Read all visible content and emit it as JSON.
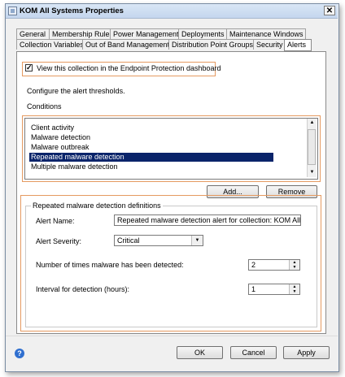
{
  "window": {
    "title": "KOM All Systems Properties",
    "close_label": "✕"
  },
  "tabs": {
    "row1": [
      "General",
      "Membership Rules",
      "Power Management",
      "Deployments",
      "Maintenance Windows"
    ],
    "row2": [
      "Collection Variables",
      "Out of Band Management",
      "Distribution Point Groups",
      "Security",
      "Alerts"
    ],
    "active": "Alerts"
  },
  "alerts": {
    "ep_checkbox_label": "View this collection in the Endpoint Protection dashboard",
    "ep_checked": true,
    "configure_text": "Configure the alert thresholds.",
    "conditions_label": "Conditions",
    "conditions": [
      "Client activity",
      "Malware detection",
      "Malware outbreak",
      "Repeated malware detection",
      "Multiple malware detection"
    ],
    "selected_condition": "Repeated malware detection",
    "add_button": "Add...",
    "remove_button": "Remove"
  },
  "definitions": {
    "group_title": "Repeated malware detection definitions",
    "alert_name_label": "Alert Name:",
    "alert_name_value": "Repeated malware detection alert for collection: KOM All Sys",
    "severity_label": "Alert Severity:",
    "severity_value": "Critical",
    "times_label": "Number of times malware has been detected:",
    "times_value": "2",
    "interval_label": "Interval for detection (hours):",
    "interval_value": "1"
  },
  "buttons": {
    "ok": "OK",
    "cancel": "Cancel",
    "apply": "Apply"
  },
  "colors": {
    "accent_orange": "#e59a61",
    "selection": "#0a246a"
  }
}
